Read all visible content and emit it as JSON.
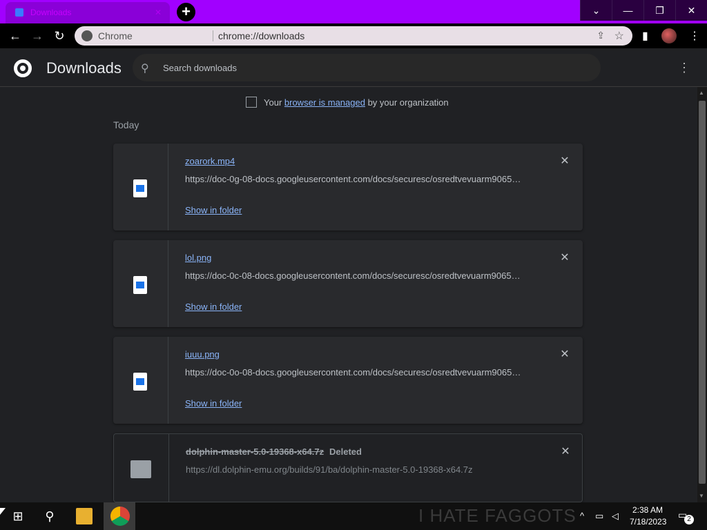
{
  "window": {
    "tab_title": "Downloads",
    "new_tab_label": "+",
    "controls": {
      "dropdown": "⌄",
      "minimize": "—",
      "restore": "❐",
      "close": "✕"
    },
    "accent_color": "#a100ff"
  },
  "toolbar": {
    "back": "←",
    "forward": "→",
    "reload": "↻",
    "omnibox_label": "Chrome",
    "omnibox_url": "chrome://downloads",
    "share": "⇪",
    "star": "☆",
    "sidebar": "▮",
    "menu": "⋮"
  },
  "header": {
    "title": "Downloads",
    "search_placeholder": "Search downloads",
    "more": "⋮"
  },
  "managed": {
    "prefix": "Your ",
    "link": "browser is managed",
    "suffix": " by your organization"
  },
  "section_label": "Today",
  "downloads": [
    {
      "name": "zoarork.mp4",
      "url": "https://doc-0g-08-docs.googleusercontent.com/docs/securesc/osredtvevuarm9065…",
      "action": "Show in folder",
      "close": "✕"
    },
    {
      "name": "lol.png",
      "url": "https://doc-0c-08-docs.googleusercontent.com/docs/securesc/osredtvevuarm9065…",
      "action": "Show in folder",
      "close": "✕"
    },
    {
      "name": "iuuu.png",
      "url": "https://doc-0o-08-docs.googleusercontent.com/docs/securesc/osredtvevuarm9065…",
      "action": "Show in folder",
      "close": "✕"
    },
    {
      "name": "dolphin-master-5.0-19368-x64.7z",
      "status": "Deleted",
      "url": "https://dl.dolphin-emu.org/builds/91/ba/dolphin-master-5.0-19368-x64.7z",
      "close": "✕"
    }
  ],
  "taskbar": {
    "banner_text": "I HATE FAGGOTS",
    "time": "2:38 AM",
    "date": "7/18/2023",
    "notification_count": "2",
    "tray_chevron": "^"
  }
}
